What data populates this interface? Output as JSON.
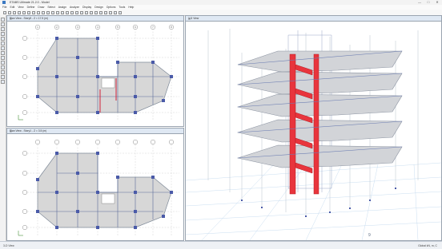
{
  "window": {
    "title": "ETABS Ultimate 21.2.0 - Model",
    "minimize": "—",
    "maximize": "□",
    "close": "✕"
  },
  "menu": [
    "File",
    "Edit",
    "View",
    "Define",
    "Draw",
    "Select",
    "Assign",
    "Analyze",
    "Display",
    "Design",
    "Options",
    "Tools",
    "Help"
  ],
  "toolbar_icons": [
    "new-file-icon",
    "open-icon",
    "save-icon",
    "undo-icon",
    "redo-icon",
    "refresh-icon",
    "lock-icon",
    "run-icon",
    "zoom-in-icon",
    "zoom-out-icon",
    "zoom-fit-icon",
    "pan-icon",
    "3d-view-icon",
    "plan-view-icon",
    "elevation-icon",
    "rotate-icon",
    "perspective-icon",
    "up-icon",
    "down-icon",
    "display-icon",
    "select-icon",
    "pointer-icon",
    "grid-icon",
    "snap-icon",
    "unit-icon"
  ],
  "panels": {
    "top_plan": {
      "title": "Plan View - Story5 - Z = 17.5 (m)"
    },
    "bottom_plan": {
      "title": "Plan View - Story1 - Z = 3.5 (m)"
    },
    "view3d": {
      "title": "3-D View"
    }
  },
  "grid_bubbles": [
    "1",
    "2",
    "3",
    "4",
    "5",
    "6",
    "7",
    "8",
    "9"
  ],
  "status": {
    "left": "3-D View",
    "units": "Global    kN, m, C"
  }
}
